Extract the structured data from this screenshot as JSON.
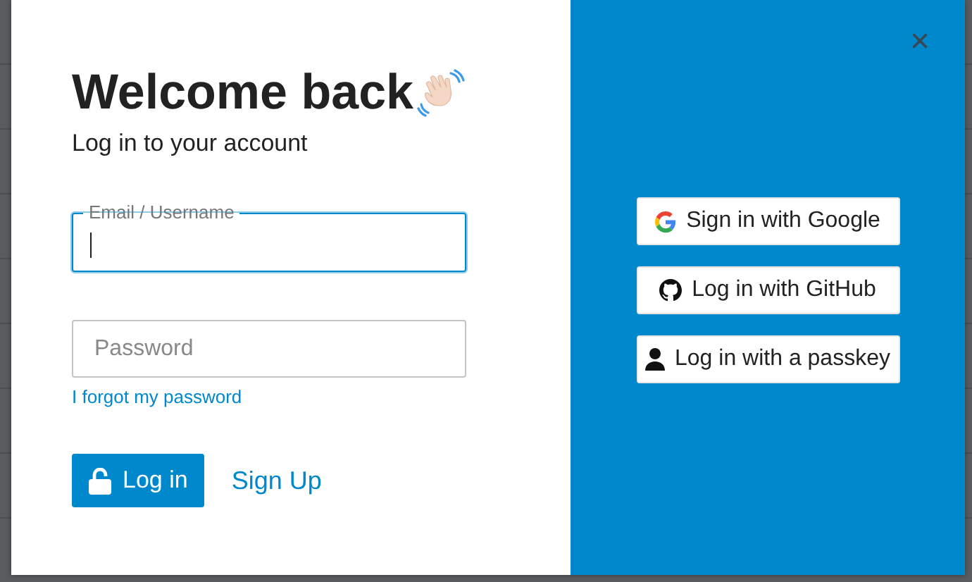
{
  "dialog": {
    "title": "Welcome back",
    "subtitle": "Log in to your account",
    "close": "×"
  },
  "fields": [
    {
      "kind": "email",
      "label": "Email / Username",
      "focused": true
    },
    {
      "kind": "password",
      "placeholder": "Password",
      "focused": false
    }
  ],
  "forgot_link": "I forgot my password",
  "login_button": "Log in",
  "signup_link": "Sign Up",
  "social_buttons": [
    {
      "kind": "google",
      "label": "Sign in with Google"
    },
    {
      "kind": "github",
      "label": "Log in with GitHub"
    },
    {
      "kind": "passkey",
      "label": "Log in with a passkey"
    }
  ]
}
